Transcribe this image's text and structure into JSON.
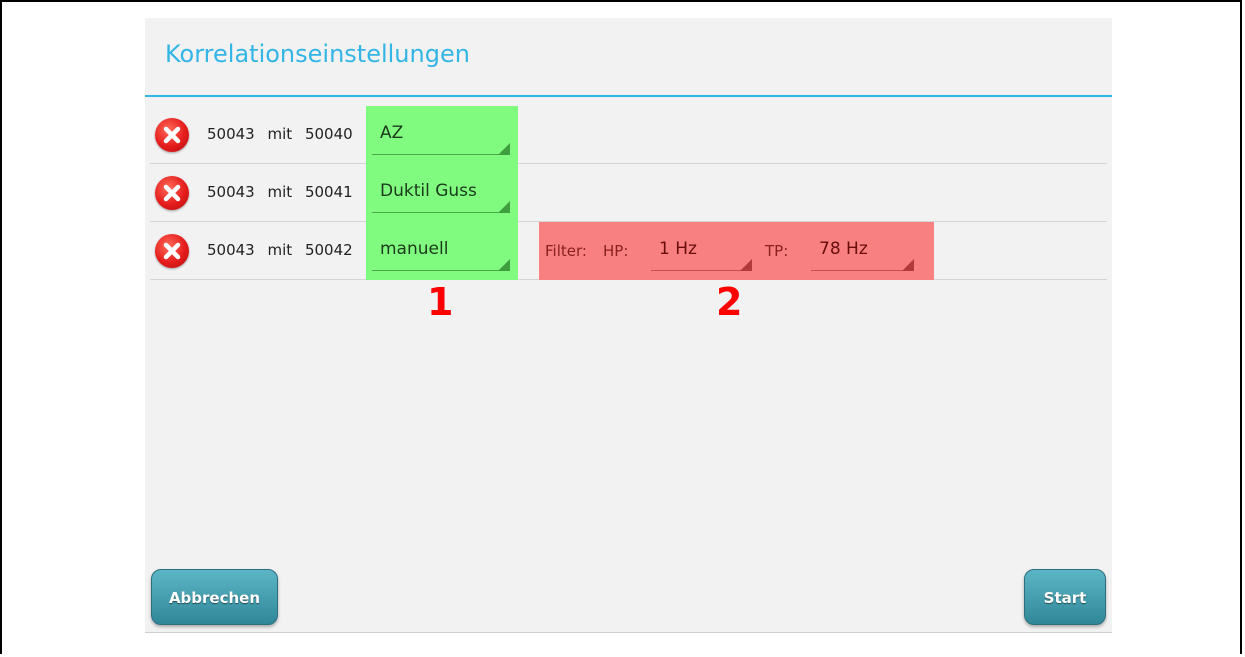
{
  "dialog": {
    "title": "Korrelationseinstellungen"
  },
  "rows": [
    {
      "from": "50043",
      "connector": "mit",
      "to": "50040",
      "material": "AZ"
    },
    {
      "from": "50043",
      "connector": "mit",
      "to": "50041",
      "material": "Duktil Guss"
    },
    {
      "from": "50043",
      "connector": "mit",
      "to": "50042",
      "material": "manuell"
    }
  ],
  "filter": {
    "label": "Filter:",
    "hp_label": "HP:",
    "hp_value": "1 Hz",
    "tp_label": "TP:",
    "tp_value": "78 Hz"
  },
  "markers": {
    "one": "1",
    "two": "2"
  },
  "footer": {
    "cancel_label": "Abbrechen",
    "start_label": "Start"
  },
  "colors": {
    "accent": "#33b5e5",
    "highlight_green": "#80fb80",
    "highlight_red": "#f88080",
    "marker_red": "#ff0000",
    "button_teal": "#3a96a6"
  },
  "icons": {
    "delete": "close-circle-icon",
    "dropdown": "spinner-triangle-icon"
  }
}
